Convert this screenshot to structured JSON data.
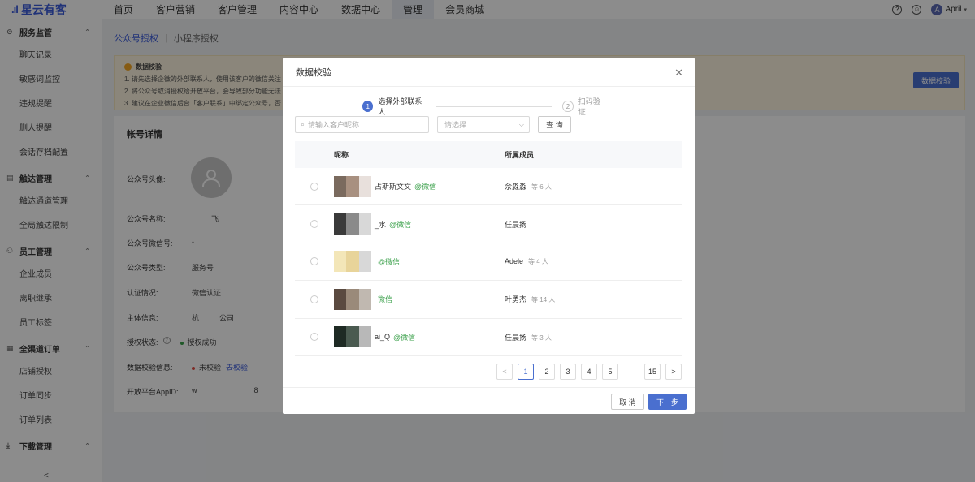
{
  "app": {
    "logo": "星云有客"
  },
  "topnav": [
    "首页",
    "客户营销",
    "客户管理",
    "内容中心",
    "数据中心",
    "管理",
    "会员商城"
  ],
  "topnav_active_index": 5,
  "user": {
    "initial": "A",
    "name": "April"
  },
  "sidebar": {
    "groups": [
      {
        "title": "服务监管",
        "icon": "location-icon",
        "items": [
          "聊天记录",
          "敏感词监控",
          "违规提醒",
          "删人提醒",
          "会话存档配置"
        ]
      },
      {
        "title": "触达管理",
        "icon": "doc-icon",
        "items": [
          "触达通道管理",
          "全局触达限制"
        ]
      },
      {
        "title": "员工管理",
        "icon": "person-icon",
        "items": [
          "企业成员",
          "离职继承",
          "员工标签"
        ]
      },
      {
        "title": "全渠道订单",
        "icon": "grid-icon",
        "items": [
          "店铺授权",
          "订单同步",
          "订单列表"
        ]
      },
      {
        "title": "下载管理",
        "icon": "download-icon",
        "items": []
      }
    ],
    "collapse": "<"
  },
  "tabs": {
    "active": "公众号授权",
    "inactive": "小程序授权"
  },
  "notice": {
    "title": "数据校验",
    "lines": [
      "1. 请先选择企微的外部联系人，使用该客户的微信关注",
      "2. 将公众号取消授权给开放平台，会导致部分功能无法",
      "3. 建议在企业微信后台「客户联系」中绑定公众号，否"
    ],
    "button": "数据校验"
  },
  "detail": {
    "title": "帐号详情",
    "rows": [
      {
        "k": "公众号头像:",
        "v": ""
      },
      {
        "k": "公众号名称:",
        "v": "飞"
      },
      {
        "k": "公众号微信号:",
        "v": "-"
      },
      {
        "k": "公众号类型:",
        "v": "服务号"
      },
      {
        "k": "认证情况:",
        "v": "微信认证"
      },
      {
        "k": "主体信息:",
        "v": "杭          公司"
      },
      {
        "k": "授权状态:",
        "v": "授权成功"
      },
      {
        "k": "数据校验信息:",
        "v": "未校验",
        "link": "去校验"
      },
      {
        "k": "开放平台AppID:",
        "v": "w                            8"
      }
    ]
  },
  "modal": {
    "title": "数据校验",
    "steps": [
      {
        "num": "1",
        "label": "选择外部联系人",
        "active": true
      },
      {
        "num": "2",
        "label": "扫码验证",
        "active": false
      }
    ],
    "search_placeholder": "请输入客户昵称",
    "select_placeholder": "请选择",
    "query_button": "查 询",
    "columns": [
      "昵称",
      "所属成员"
    ],
    "rows": [
      {
        "nick": "占斯斯文文",
        "tag": "@微信",
        "member": "佘淼淼",
        "more": "等 6 人",
        "colors": [
          "#7a6a5e",
          "#a89080",
          "#e8e0dc"
        ]
      },
      {
        "nick": "_水",
        "tag": "@微信",
        "member": "任晨扬",
        "more": "",
        "colors": [
          "#3a3a3a",
          "#8a8a8a",
          "#d8d8d8"
        ]
      },
      {
        "nick": "",
        "tag": "@微信",
        "member": "Adele",
        "more": "等 4 人",
        "colors": [
          "#f3e6b8",
          "#e8d49a",
          "#d8d8d8"
        ]
      },
      {
        "nick": "",
        "tag": "微信",
        "member": "叶勇杰",
        "more": "等 14 人",
        "colors": [
          "#5a4a40",
          "#9a8a7a",
          "#c0b8b0"
        ]
      },
      {
        "nick": "ai_Q",
        "tag": "@微信",
        "member": "任晨扬",
        "more": "等 3 人",
        "colors": [
          "#1e2a24",
          "#4a5a50",
          "#b8b8b8"
        ]
      }
    ],
    "pagination": {
      "pages": [
        "1",
        "2",
        "3",
        "4",
        "5"
      ],
      "ellipsis": "···",
      "last": "15",
      "current": "1",
      "prev": "<",
      "next": ">"
    },
    "cancel": "取 消",
    "next": "下一步"
  },
  "colors": {
    "primary": "#4a6fcf",
    "wechat_green": "#3aa04a",
    "notice_bg": "#fdf5e0"
  }
}
